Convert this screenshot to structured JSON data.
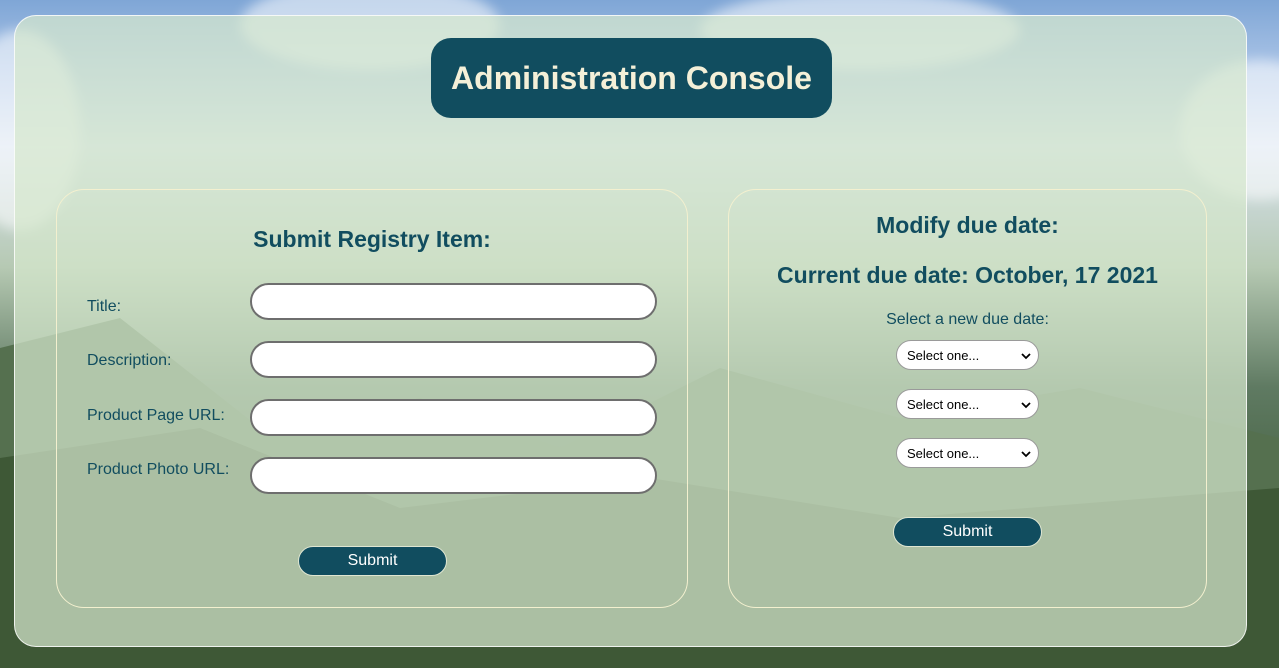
{
  "header": {
    "title": "Administration Console"
  },
  "registry_form": {
    "heading": "Submit Registry Item:",
    "fields": [
      {
        "label": "Title:",
        "value": ""
      },
      {
        "label": "Description:",
        "value": ""
      },
      {
        "label": "Product Page URL:",
        "value": ""
      },
      {
        "label": "Product Photo URL:",
        "value": ""
      }
    ],
    "submit_label": "Submit"
  },
  "due_date_form": {
    "heading": "Modify due date:",
    "current_due_date": "Current due date: October, 17 2021",
    "prompt": "Select a new due date:",
    "selects": [
      {
        "selected": "Select one..."
      },
      {
        "selected": "Select one..."
      },
      {
        "selected": "Select one..."
      }
    ],
    "submit_label": "Submit"
  },
  "colors": {
    "accent": "#114d5f",
    "title_text": "#f4f0d8",
    "panel_bg": "#d6e8cd"
  }
}
